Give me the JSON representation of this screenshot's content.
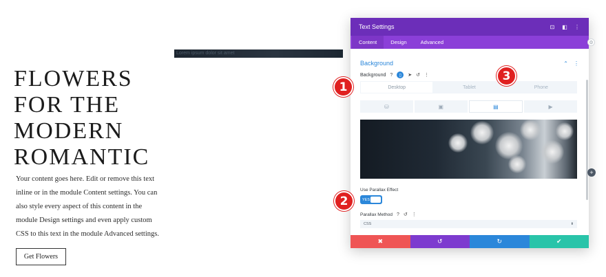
{
  "page": {
    "title_lines": [
      "FLOWERS",
      "FOR THE",
      "MODERN",
      "ROMANTIC"
    ],
    "body_text": "Your content goes here. Edit or remove this text inline or in the module Content settings. You can also style every aspect of this content in the module Design settings and even apply custom CSS to this text in the module Advanced settings.",
    "cta_label": "Get Flowers",
    "strip_text": "Lorem ipsum dolor sit amet"
  },
  "modal": {
    "title": "Text Settings",
    "tabs": [
      {
        "label": "Content",
        "active": true
      },
      {
        "label": "Design",
        "active": false
      },
      {
        "label": "Advanced",
        "active": false
      }
    ],
    "section_title": "Background",
    "background_label": "Background",
    "device_tabs": [
      "Desktop",
      "Tablet",
      "Phone"
    ],
    "type_tab_icons": [
      "color-icon",
      "gradient-icon",
      "image-icon",
      "video-icon"
    ],
    "parallax_label": "Use Parallax Effect",
    "parallax_toggle": "YES",
    "parallax_method_label": "Parallax Method",
    "parallax_method_value": "CSS"
  },
  "badges": [
    "1",
    "2",
    "3"
  ],
  "colors": {
    "header": "#6c2eb9",
    "tabs": "#8b3fd8",
    "accent": "#2b87da",
    "cancel": "#ef5555",
    "undo": "#7d3bcf",
    "redo": "#2b87da",
    "save": "#29c4a9",
    "badge": "#e02020"
  }
}
